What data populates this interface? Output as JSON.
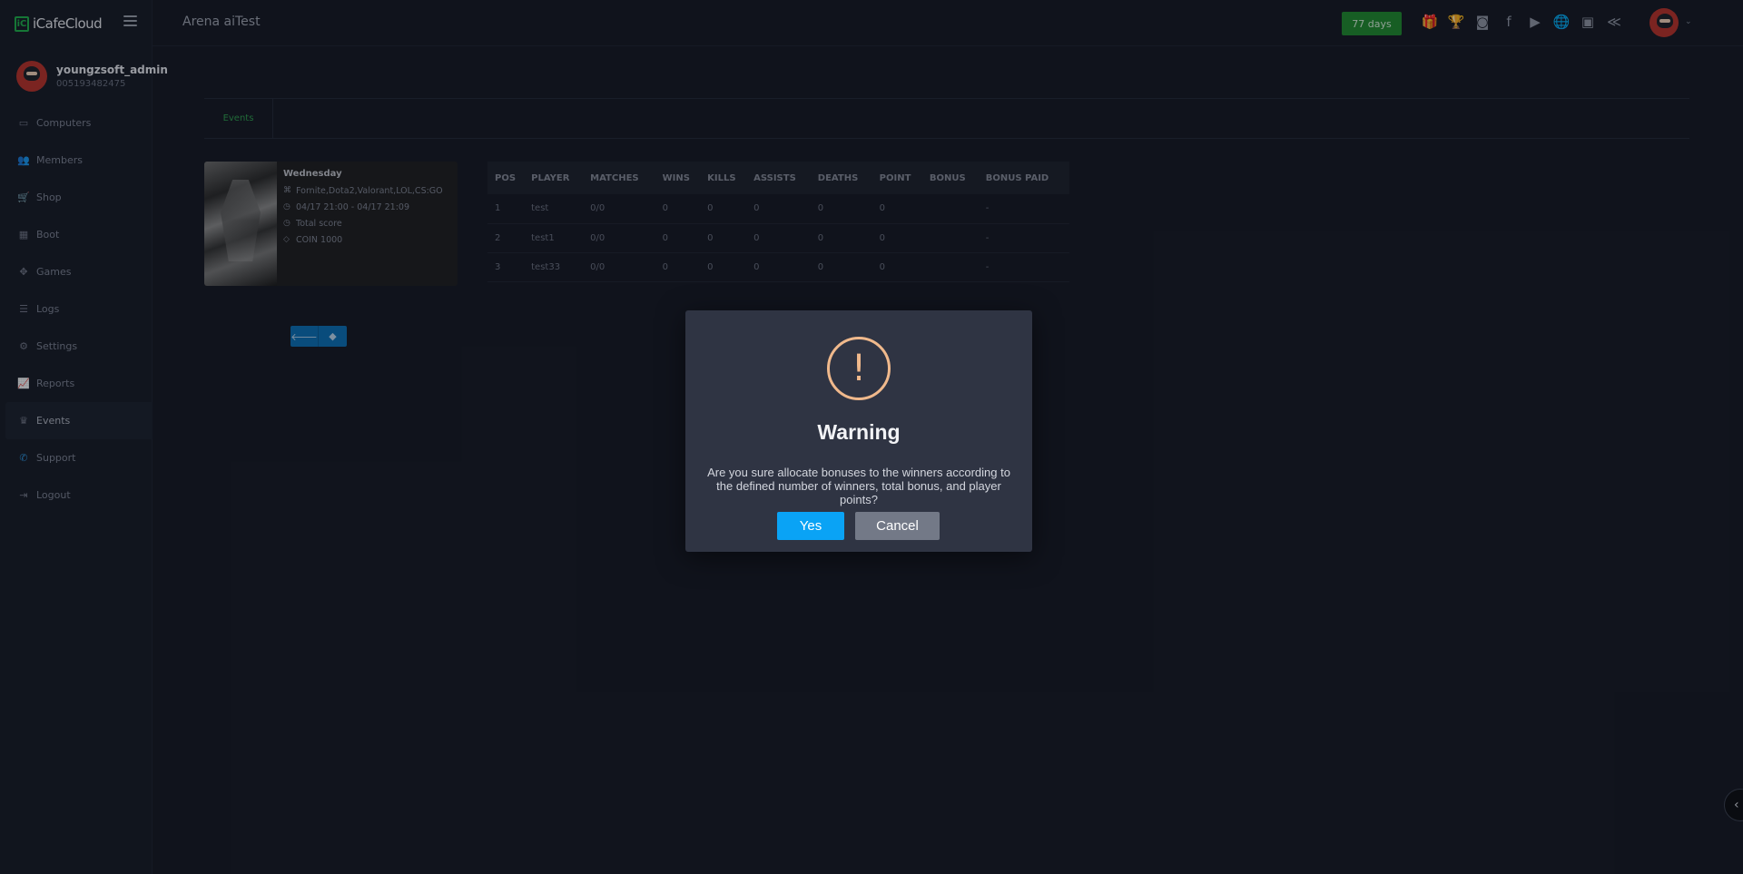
{
  "app": {
    "logo_mark": "iC",
    "logo_text": "iCafeCloud"
  },
  "user": {
    "name": "youngzsoft_admin",
    "id": "005193482475"
  },
  "nav": [
    {
      "label": "Computers",
      "icon": "monitor-icon",
      "glyph": "▭"
    },
    {
      "label": "Members",
      "icon": "users-icon",
      "glyph": "👥"
    },
    {
      "label": "Shop",
      "icon": "cart-icon",
      "glyph": "🛒"
    },
    {
      "label": "Boot",
      "icon": "windows-icon",
      "glyph": "▦"
    },
    {
      "label": "Games",
      "icon": "gamepad-icon",
      "glyph": "✥"
    },
    {
      "label": "Logs",
      "icon": "list-icon",
      "glyph": "☰"
    },
    {
      "label": "Settings",
      "icon": "gear-icon",
      "glyph": "⚙"
    },
    {
      "label": "Reports",
      "icon": "chart-icon",
      "glyph": "📈"
    },
    {
      "label": "Events",
      "icon": "crown-icon",
      "glyph": "♛"
    },
    {
      "label": "Support",
      "icon": "phone-icon",
      "glyph": "✆"
    },
    {
      "label": "Logout",
      "icon": "logout-icon",
      "glyph": "⇥"
    }
  ],
  "header": {
    "title": "Arena aiTest",
    "days_badge": "77 days",
    "icons": [
      {
        "name": "gift-icon",
        "glyph": "🎁"
      },
      {
        "name": "trophy-icon",
        "glyph": "🏆"
      },
      {
        "name": "discord-icon",
        "glyph": "◙"
      },
      {
        "name": "facebook-icon",
        "glyph": "f"
      },
      {
        "name": "youtube-icon",
        "glyph": "▶"
      },
      {
        "name": "globe-icon",
        "glyph": "🌐"
      },
      {
        "name": "icafe-icon",
        "glyph": "▣"
      },
      {
        "name": "chevrons-icon",
        "glyph": "≪"
      }
    ]
  },
  "tabs": [
    {
      "label": "Events"
    }
  ],
  "event": {
    "title": "Wednesday",
    "games": "Fornite,Dota2,Valorant,LOL,CS:GO",
    "time": "04/17 21:00 - 04/17 21:09",
    "score_type": "Total score",
    "prize": "COIN 1000"
  },
  "table": {
    "headers": [
      "POS",
      "PLAYER",
      "MATCHES",
      "WINS",
      "KILLS",
      "ASSISTS",
      "DEATHS",
      "POINT",
      "BONUS",
      "BONUS PAID"
    ],
    "rows": [
      [
        "1",
        "test",
        "0/0",
        "0",
        "0",
        "0",
        "0",
        "0",
        "",
        "-"
      ],
      [
        "2",
        "test1",
        "0/0",
        "0",
        "0",
        "0",
        "0",
        "0",
        "",
        "-"
      ],
      [
        "3",
        "test33",
        "0/0",
        "0",
        "0",
        "0",
        "0",
        "0",
        "",
        "-"
      ]
    ]
  },
  "modal": {
    "icon_glyph": "!",
    "title": "Warning",
    "message": "Are you sure allocate bonuses to the winners according to the defined number of winners, total bonus, and player points?",
    "yes_label": "Yes",
    "cancel_label": "Cancel"
  },
  "colors": {
    "accent_green": "#1f8a2e",
    "primary_blue": "#0aa3f5",
    "warning": "#f0b98c"
  }
}
